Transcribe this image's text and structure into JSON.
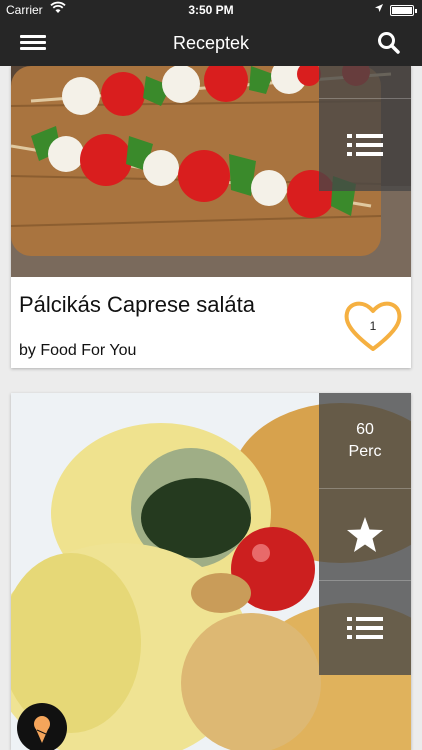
{
  "status": {
    "carrier": "Carrier",
    "time": "3:50 PM"
  },
  "nav": {
    "title": "Receptek"
  },
  "cards": [
    {
      "title": "Pálcikás Caprese saláta",
      "author": "by Food For You",
      "likes": "1"
    },
    {
      "time_value": "60",
      "time_unit": "Perc"
    }
  ],
  "icons": {
    "menu": "hamburger-menu-icon",
    "search": "search-icon",
    "list": "list-icon",
    "heart": "heart-icon",
    "star": "star-icon",
    "icecream": "ice-cream-icon"
  },
  "colors": {
    "heart": "#f5b041",
    "nav_bg": "#262626",
    "panel": "#464646"
  }
}
